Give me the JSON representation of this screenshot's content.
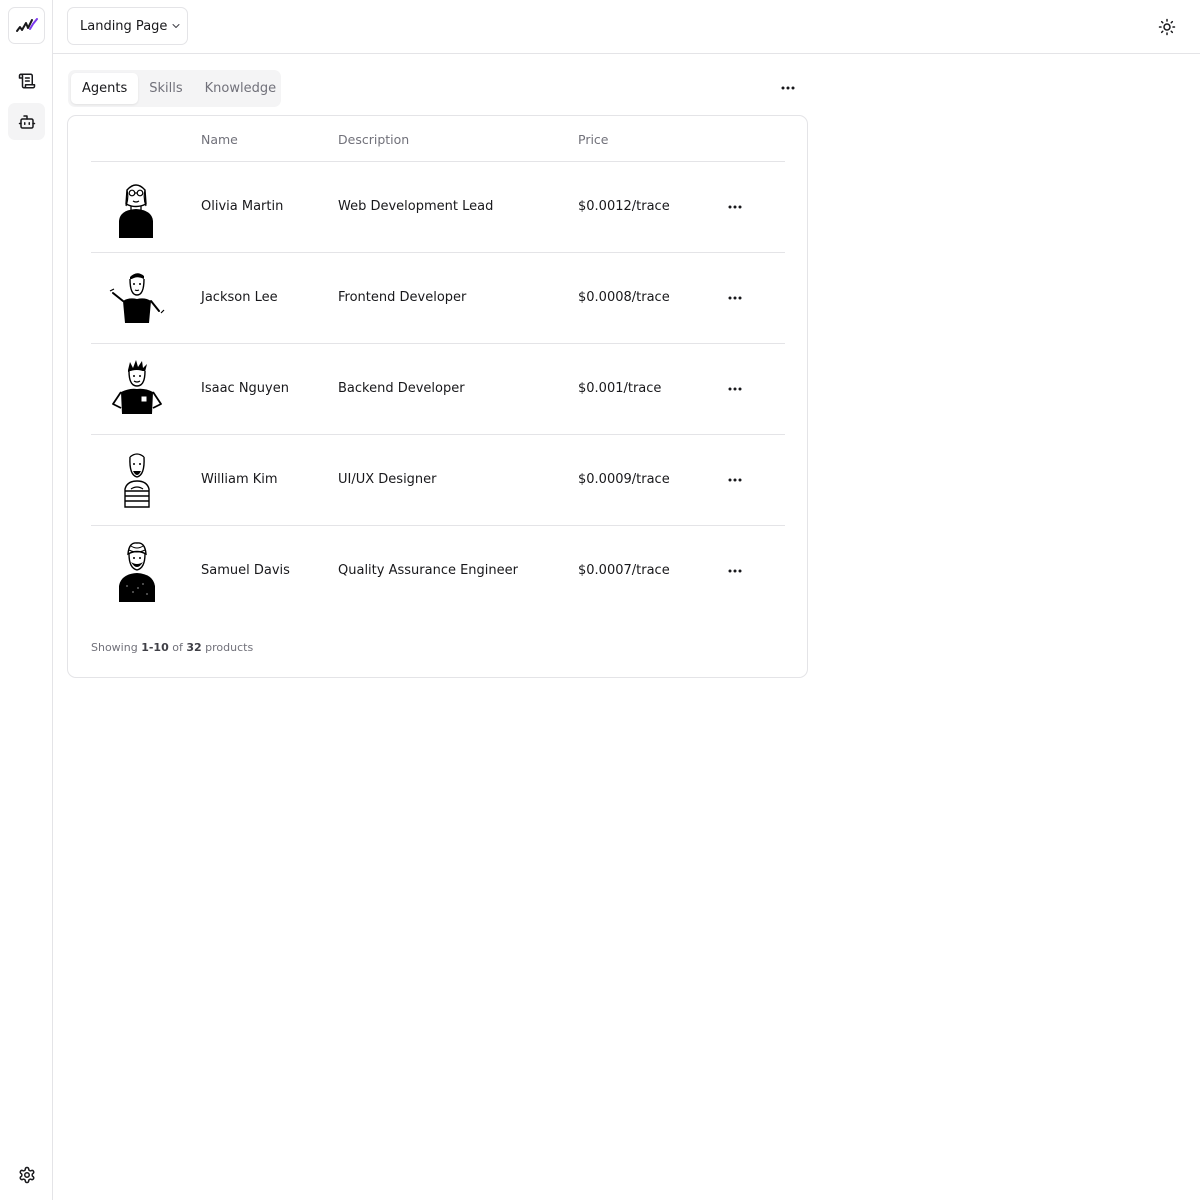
{
  "header": {
    "project_label": "Landing Page"
  },
  "tabs": [
    {
      "label": "Agents",
      "active": true
    },
    {
      "label": "Skills",
      "active": false
    },
    {
      "label": "Knowledge",
      "active": false
    }
  ],
  "table": {
    "columns": {
      "name": "Name",
      "description": "Description",
      "price": "Price"
    },
    "rows": [
      {
        "name": "Olivia Martin",
        "description": "Web Development Lead",
        "price": "$0.0012/trace"
      },
      {
        "name": "Jackson Lee",
        "description": "Frontend Developer",
        "price": "$0.0008/trace"
      },
      {
        "name": "Isaac Nguyen",
        "description": "Backend Developer",
        "price": "$0.001/trace"
      },
      {
        "name": "William Kim",
        "description": "UI/UX Designer",
        "price": "$0.0009/trace"
      },
      {
        "name": "Samuel Davis",
        "description": "Quality Assurance Engineer",
        "price": "$0.0007/trace"
      }
    ]
  },
  "footer": {
    "prefix": "Showing",
    "range": "1-10",
    "of": "of",
    "total": "32",
    "suffix": "products"
  },
  "icons": {
    "logo": "logo-icon",
    "nav_1": "scroll-icon",
    "nav_2": "bot-icon",
    "settings": "gear-icon",
    "theme": "sun-icon"
  },
  "colors": {
    "border": "#e4e4e7",
    "muted_text": "#71717a",
    "logo_accent": "#7c3aed"
  }
}
